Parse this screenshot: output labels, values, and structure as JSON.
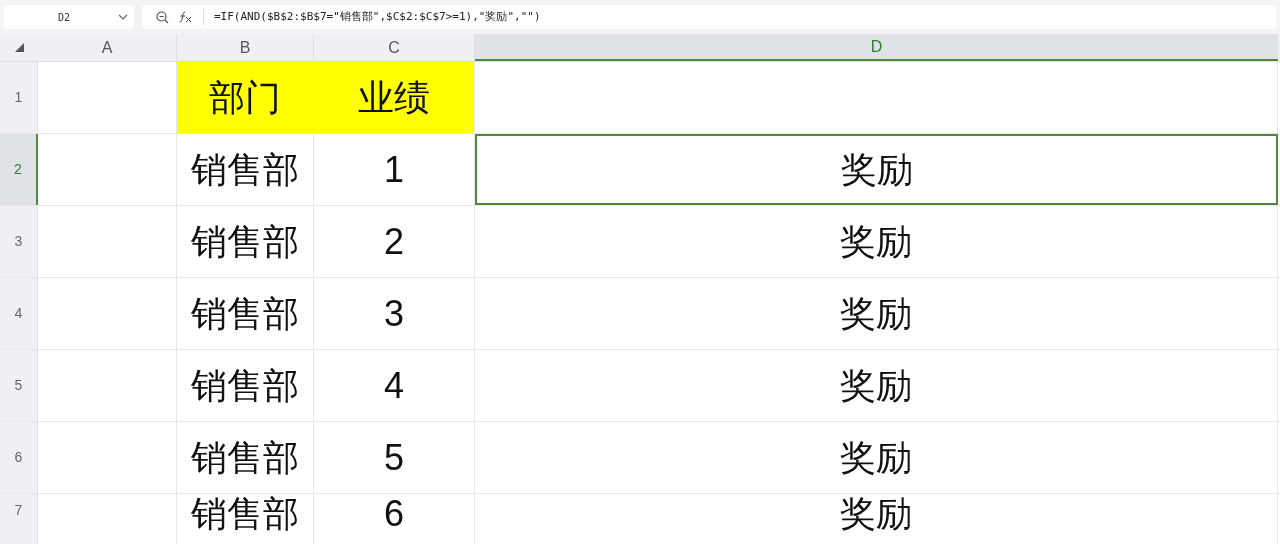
{
  "formula_bar": {
    "name_box": "D2",
    "formula": "=IF(AND($B$2:$B$7=\"销售部\",$C$2:$C$7>=1),\"奖励\",\"\")"
  },
  "columns": [
    {
      "label": "A",
      "selected": false
    },
    {
      "label": "B",
      "selected": false
    },
    {
      "label": "C",
      "selected": false
    },
    {
      "label": "D",
      "selected": true
    }
  ],
  "rows": [
    {
      "label": "1",
      "selected": false,
      "cells": {
        "B": {
          "text": "部门",
          "highlighted": true,
          "selected": false
        },
        "C": {
          "text": "业绩",
          "highlighted": true,
          "selected": false
        }
      }
    },
    {
      "label": "2",
      "selected": true,
      "cells": {
        "B": {
          "text": "销售部",
          "highlighted": false,
          "selected": false
        },
        "C": {
          "text": "1",
          "highlighted": false,
          "selected": false
        },
        "D": {
          "text": "奖励",
          "highlighted": false,
          "selected": true
        }
      }
    },
    {
      "label": "3",
      "selected": false,
      "cells": {
        "B": {
          "text": "销售部",
          "highlighted": false,
          "selected": false
        },
        "C": {
          "text": "2",
          "highlighted": false,
          "selected": false
        },
        "D": {
          "text": "奖励",
          "highlighted": false,
          "selected": false
        }
      }
    },
    {
      "label": "4",
      "selected": false,
      "cells": {
        "B": {
          "text": "销售部",
          "highlighted": false,
          "selected": false
        },
        "C": {
          "text": "3",
          "highlighted": false,
          "selected": false
        },
        "D": {
          "text": "奖励",
          "highlighted": false,
          "selected": false
        }
      }
    },
    {
      "label": "5",
      "selected": false,
      "cells": {
        "B": {
          "text": "销售部",
          "highlighted": false,
          "selected": false
        },
        "C": {
          "text": "4",
          "highlighted": false,
          "selected": false
        },
        "D": {
          "text": "奖励",
          "highlighted": false,
          "selected": false
        }
      }
    },
    {
      "label": "6",
      "selected": false,
      "cells": {
        "B": {
          "text": "销售部",
          "highlighted": false,
          "selected": false
        },
        "C": {
          "text": "5",
          "highlighted": false,
          "selected": false
        },
        "D": {
          "text": "奖励",
          "highlighted": false,
          "selected": false
        }
      }
    },
    {
      "label": "7",
      "selected": false,
      "cells": {
        "B": {
          "text": "销售部",
          "highlighted": false,
          "selected": false
        },
        "C": {
          "text": "6",
          "highlighted": false,
          "selected": false
        },
        "D": {
          "text": "奖励",
          "highlighted": false,
          "selected": false
        }
      }
    }
  ]
}
